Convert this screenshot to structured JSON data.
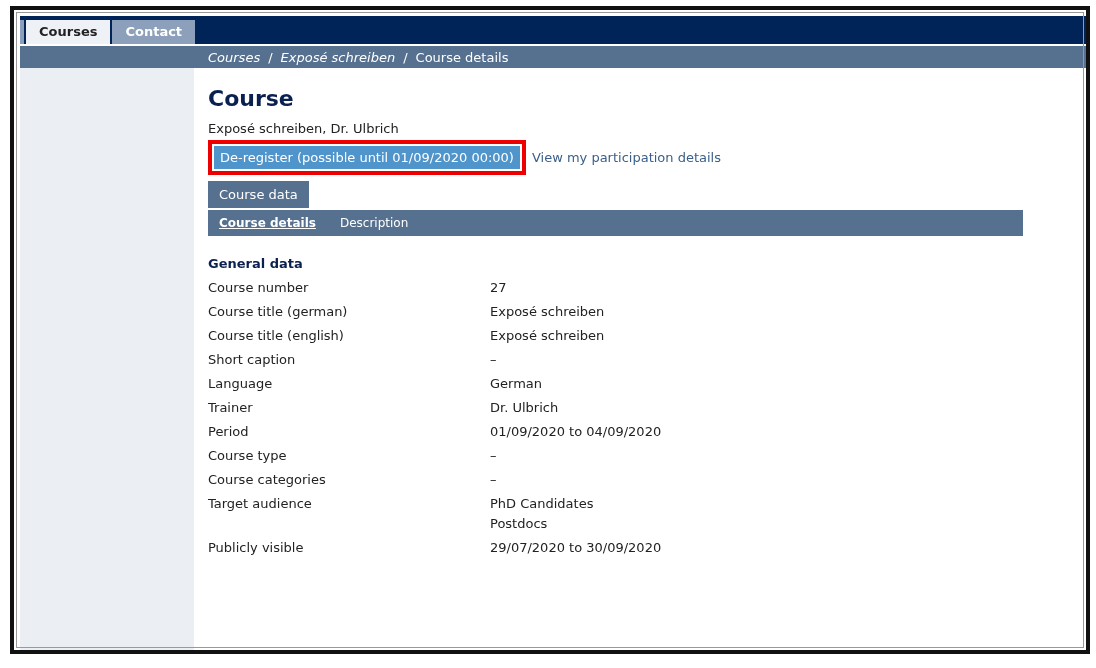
{
  "nav_tabs": [
    {
      "label": "Courses",
      "selected": true
    },
    {
      "label": "Contact",
      "selected": false
    }
  ],
  "breadcrumb_separator": "/",
  "breadcrumb": [
    {
      "label": "Courses",
      "link": true
    },
    {
      "label": "Exposé schreiben",
      "link": true
    },
    {
      "label": "Course details",
      "link": false
    }
  ],
  "heading": "Course",
  "subtitle": "Exposé schreiben, Dr. Ulbrich",
  "actions": [
    {
      "kind": "button",
      "label": "De-register (possible until 01/09/2020 00:00)",
      "highlighted": true
    },
    {
      "kind": "link",
      "label": "View my participation details",
      "highlighted": false
    }
  ],
  "section_tab": {
    "label": "Course data"
  },
  "sub_tabs": [
    {
      "label": "Course details",
      "selected": true
    },
    {
      "label": "Description",
      "selected": false
    }
  ],
  "section_title": "General data",
  "fields": [
    {
      "label": "Course number",
      "values": [
        "27"
      ]
    },
    {
      "label": "Course title (german)",
      "values": [
        "Exposé schreiben"
      ]
    },
    {
      "label": "Course title (english)",
      "values": [
        "Exposé schreiben"
      ]
    },
    {
      "label": "Short caption",
      "values": [
        "–"
      ]
    },
    {
      "label": "Language",
      "values": [
        "German"
      ]
    },
    {
      "label": "Trainer",
      "values": [
        "Dr. Ulbrich"
      ]
    },
    {
      "label": "Period",
      "values": [
        "01/09/2020 to 04/09/2020"
      ]
    },
    {
      "label": "Course type",
      "values": [
        "–"
      ]
    },
    {
      "label": "Course categories",
      "values": [
        "–"
      ]
    },
    {
      "label": "Target audience",
      "values": [
        "PhD Candidates",
        "Postdocs"
      ]
    },
    {
      "label": "Publicly visible",
      "values": [
        "29/07/2020 to 30/09/2020"
      ]
    }
  ]
}
